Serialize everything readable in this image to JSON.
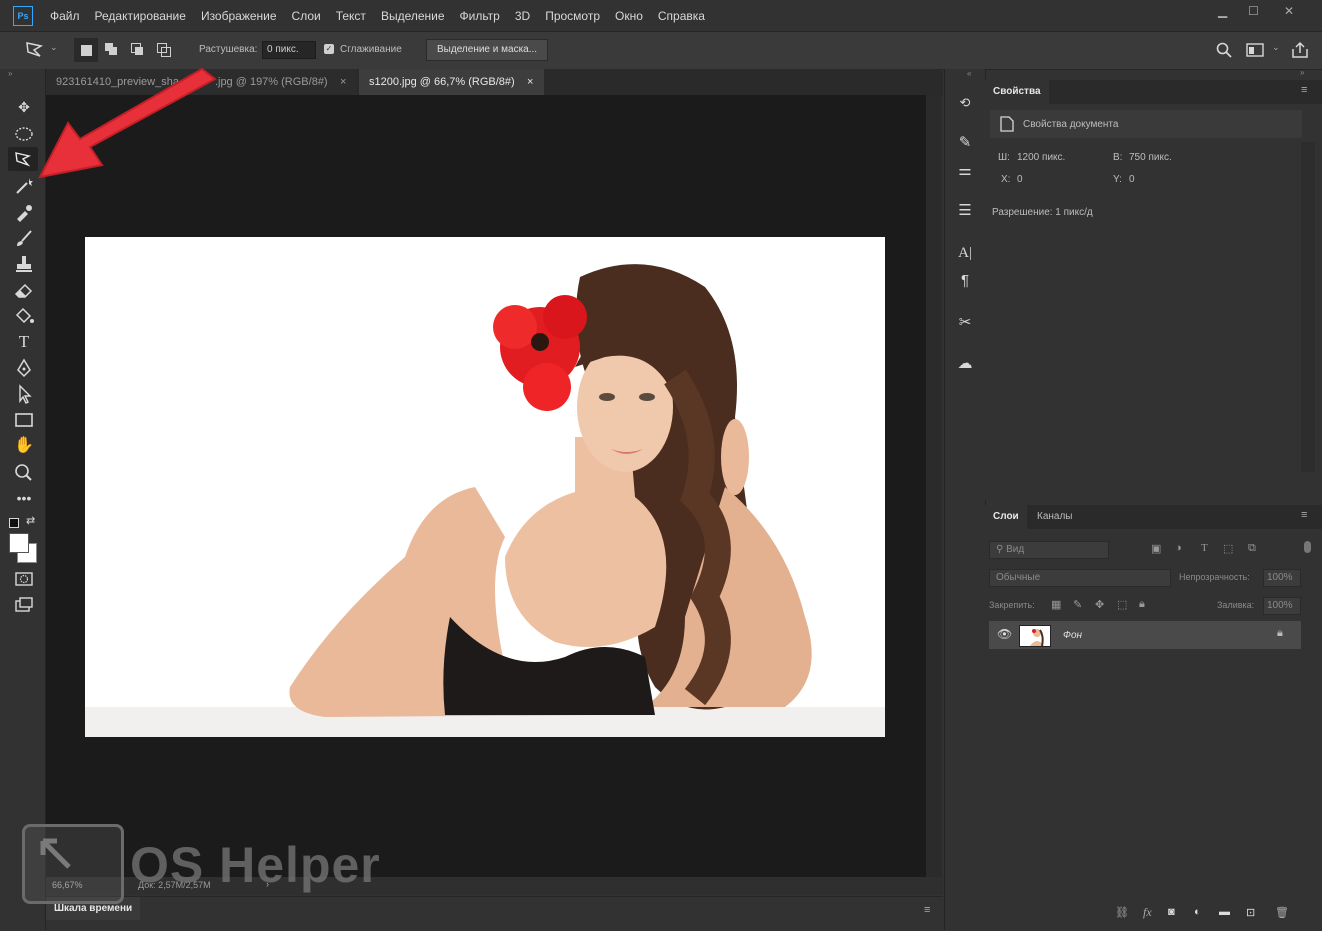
{
  "app": {
    "logo": "Ps"
  },
  "menu": [
    "Файл",
    "Редактирование",
    "Изображение",
    "Слои",
    "Текст",
    "Выделение",
    "Фильтр",
    "3D",
    "Просмотр",
    "Окно",
    "Справка"
  ],
  "window_controls": {
    "minimize": "▁",
    "maximize": "☐",
    "close": "✕"
  },
  "options": {
    "feather_label": "Растушевка:",
    "feather_value": "0 пикс.",
    "antialias_label": "Сглаживание",
    "select_mask_label": "Выделение и маска..."
  },
  "tabs": [
    {
      "label": "923161410_preview_sha",
      "label_tail": ".jpg @ 197% (RGB/8#)",
      "close": "×"
    },
    {
      "label": "s1200.jpg @ 66,7% (RGB/8#)",
      "close": "×"
    }
  ],
  "status": {
    "zoom": "66,67%",
    "doc": "Док: 2,57М/2,57М",
    "arrow": "›"
  },
  "timeline": {
    "label": "Шкала времени"
  },
  "properties": {
    "tab": "Свойства",
    "subtitle": "Свойства документа",
    "w_label": "Ш:",
    "w_value": "1200 пикс.",
    "h_label": "В:",
    "h_value": "750 пикс.",
    "x_label": "X:",
    "x_value": "0",
    "y_label": "Y:",
    "y_value": "0",
    "resolution": "Разрешение: 1 пикс/д"
  },
  "layers": {
    "tabs": [
      "Слои",
      "Каналы"
    ],
    "filter_placeholder": "Вид",
    "blend_mode": "Обычные",
    "opacity_label": "Непрозрачность:",
    "opacity_value": "100%",
    "lock_label": "Закрепить:",
    "fill_label": "Заливка:",
    "fill_value": "100%",
    "items": [
      {
        "name": "Фон"
      }
    ]
  },
  "watermark": {
    "text": "OS Helper"
  },
  "colors": {
    "accent": "#31a8ff",
    "arrow": "#e8303a"
  }
}
